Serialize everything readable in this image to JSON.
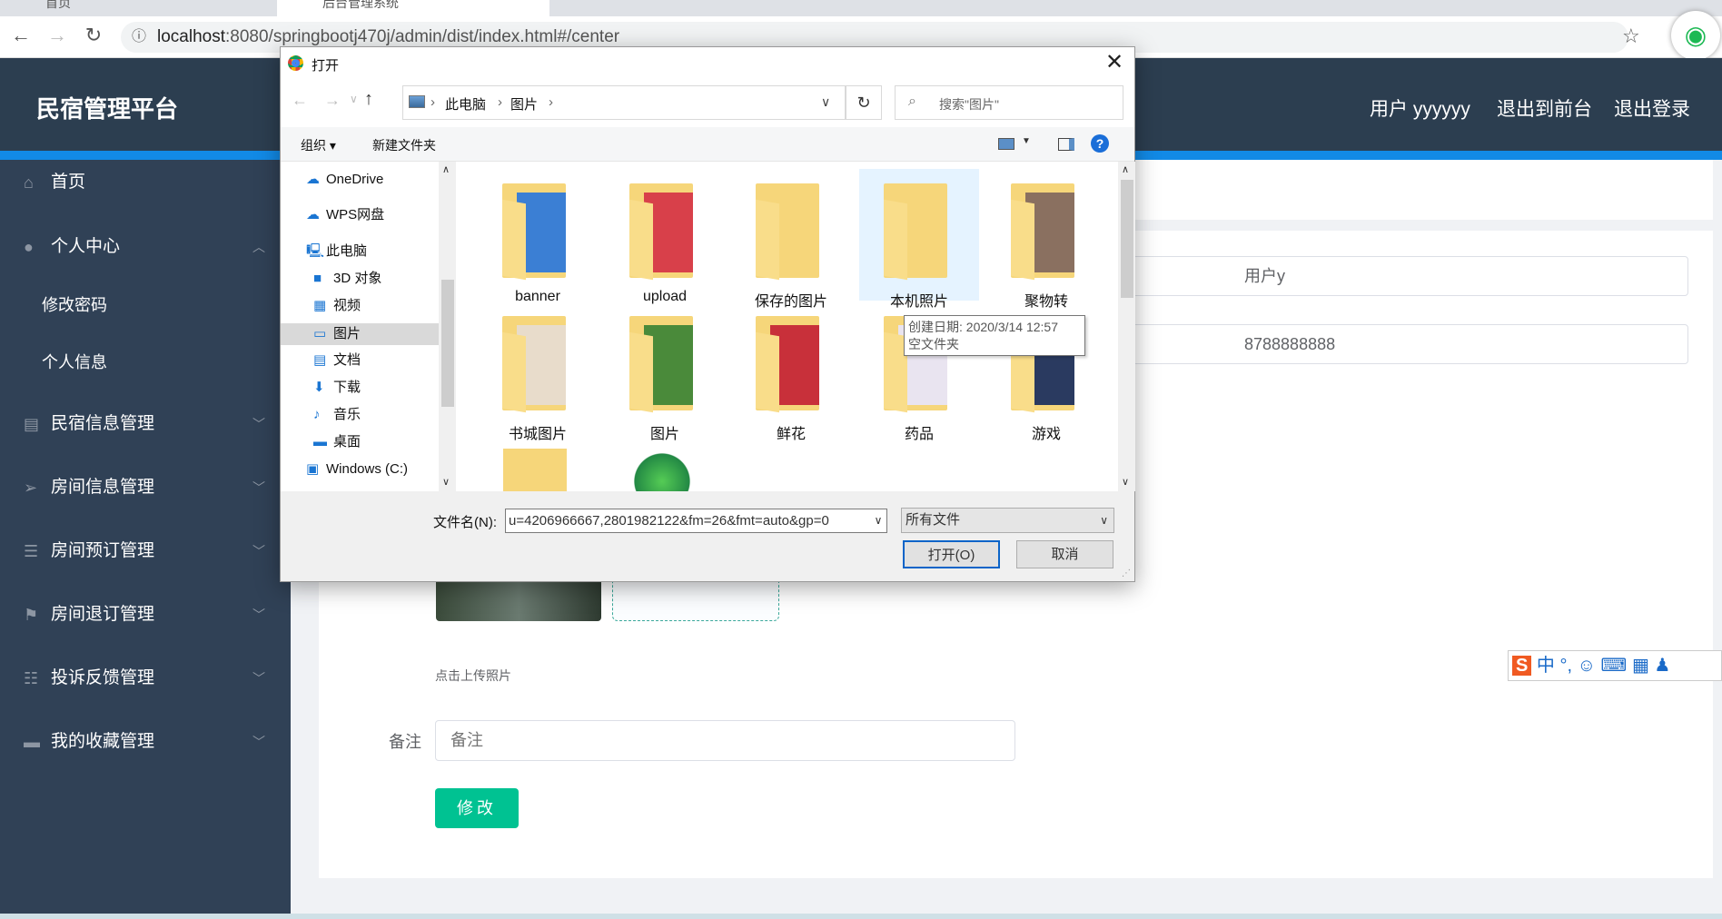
{
  "browser": {
    "tabs": [
      {
        "label": "首页"
      },
      {
        "label": "后台管理系统"
      }
    ],
    "url_host": "localhost",
    "url_rest": ":8080/springbootj470j/admin/dist/index.html#/center"
  },
  "header": {
    "title": "民宿管理平台",
    "user": "用户 yyyyyy",
    "to_front": "退出到前台",
    "logout": "退出登录"
  },
  "sidebar": {
    "items": [
      {
        "label": "首页",
        "icon": "home-icon"
      },
      {
        "label": "个人中心",
        "icon": "user-icon",
        "expanded": true
      },
      {
        "label": "修改密码",
        "sub": true
      },
      {
        "label": "个人信息",
        "sub": true
      },
      {
        "label": "民宿信息管理",
        "icon": "clipboard-icon"
      },
      {
        "label": "房间信息管理",
        "icon": "send-icon"
      },
      {
        "label": "房间预订管理",
        "icon": "list-icon"
      },
      {
        "label": "房间退订管理",
        "icon": "flag-icon"
      },
      {
        "label": "投诉反馈管理",
        "icon": "sliders-icon"
      },
      {
        "label": "我的收藏管理",
        "icon": "monitor-icon"
      }
    ]
  },
  "form": {
    "name_value": "用户y",
    "phone_value": "8788888888",
    "upload_hint": "点击上传照片",
    "remark_label": "备注",
    "remark_placeholder": "备注",
    "submit": "修改"
  },
  "dialog": {
    "title": "打开",
    "breadcrumb": [
      "此电脑",
      "图片"
    ],
    "search_placeholder": "搜索\"图片\"",
    "organize": "组织 ▾",
    "new_folder": "新建文件夹",
    "nav": [
      {
        "label": "OneDrive",
        "icon": "cloud-icon"
      },
      {
        "label": "WPS网盘",
        "icon": "cloud-icon"
      },
      {
        "label": "此电脑",
        "icon": "computer-icon"
      },
      {
        "label": "3D 对象",
        "icon": "cube-icon"
      },
      {
        "label": "视频",
        "icon": "film-icon"
      },
      {
        "label": "图片",
        "icon": "picture-icon",
        "selected": true
      },
      {
        "label": "文档",
        "icon": "document-icon"
      },
      {
        "label": "下载",
        "icon": "download-icon"
      },
      {
        "label": "音乐",
        "icon": "music-icon"
      },
      {
        "label": "桌面",
        "icon": "desktop-icon"
      },
      {
        "label": "Windows (C:)",
        "icon": "drive-icon"
      }
    ],
    "folders": [
      {
        "label": "banner",
        "preview": "#3b7fd4"
      },
      {
        "label": "upload",
        "preview": "#d8404a"
      },
      {
        "label": "保存的图片",
        "preview": ""
      },
      {
        "label": "本机照片",
        "preview": "",
        "selected": true
      },
      {
        "label": "聚物转",
        "preview": "#8a7060"
      },
      {
        "label": "书城图片",
        "preview": "#e8dccb"
      },
      {
        "label": "图片",
        "preview": "#4a8a3a"
      },
      {
        "label": "鲜花",
        "preview": "#c8303a"
      },
      {
        "label": "药品",
        "preview": "#e9e4f0"
      },
      {
        "label": "游戏",
        "preview": "#2a3a60"
      }
    ],
    "tooltip": {
      "line1": "创建日期: 2020/3/14 12:57",
      "line2": "空文件夹"
    },
    "filename_label": "文件名(N):",
    "filename_value": "u=4206966667,2801982122&fm=26&fmt=auto&gp=0",
    "filter": "所有文件",
    "open": "打开(O)",
    "cancel": "取消"
  },
  "ime": {
    "lang": "中"
  }
}
